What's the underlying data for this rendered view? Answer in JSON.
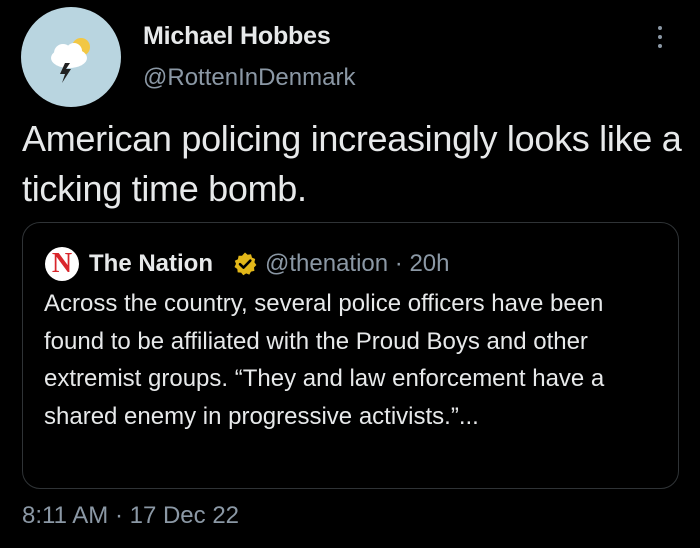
{
  "author": {
    "name": "Michael Hobbes",
    "handle": "@RottenInDenmark",
    "avatar_icon": "storm-cloud-icon"
  },
  "more_icon": "more-options-icon",
  "tweet": {
    "text": "American policing increasingly looks like a ticking time bomb."
  },
  "quoted": {
    "logo_letter": "N",
    "name": "The Nation",
    "verified_icon": "verified-badge-icon",
    "meta": "@thenation · 20h",
    "text": "Across the country, several police officers have been found to be affiliated with the Proud Boys and other extremist groups. “They and law enforcement have a shared enemy in progressive activists.”..."
  },
  "timestamp": "8:11 AM · 17 Dec 22",
  "colors": {
    "background": "#000000",
    "text": "#e7e9ea",
    "secondary": "#8b98a5",
    "verified_gold": "#e2b719",
    "nation_red": "#d9262c"
  }
}
